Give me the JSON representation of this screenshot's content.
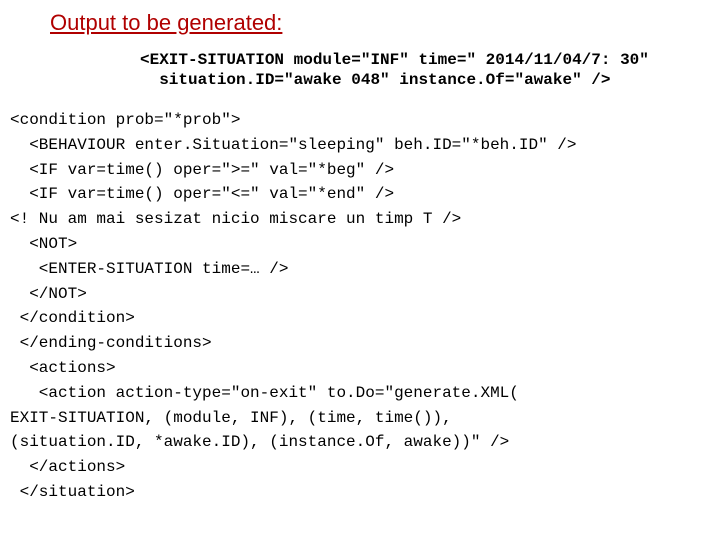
{
  "title": "Output to be generated:",
  "header": {
    "l1": "<EXIT-SITUATION module=\"INF\" time=\" 2014/11/04/7: 30\"",
    "l2": "  situation.ID=\"awake 048\" instance.Of=\"awake\" />"
  },
  "code": {
    "l1": "<condition prob=\"*prob\">",
    "l2": "  <BEHAVIOUR enter.Situation=\"sleeping\" beh.ID=\"*beh.ID\" />",
    "l3": "  <IF var=time() oper=\">=\" val=\"*beg\" />",
    "l4": "  <IF var=time() oper=\"<=\" val=\"*end\" />",
    "l5": "<! Nu am mai sesizat nicio miscare un timp T />",
    "l6": "  <NOT>",
    "l7": "   <ENTER-SITUATION time=… />",
    "l8": "  </NOT>",
    "l9": " </condition>",
    "l10": " </ending-conditions>",
    "l11": "  <actions>",
    "l12": "   <action action-type=\"on-exit\" to.Do=\"generate.XML(",
    "l13": "EXIT-SITUATION, (module, INF), (time, time()),",
    "l14": "(situation.ID, *awake.ID), (instance.Of, awake))\" />",
    "l15": "  </actions>",
    "l16": " </situation>"
  }
}
